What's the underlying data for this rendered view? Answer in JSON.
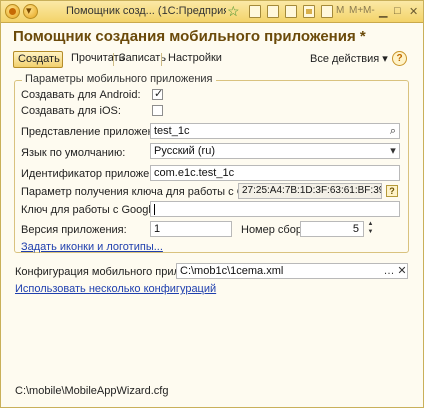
{
  "window": {
    "title": "Помощник созд... (1С:Предприятие)",
    "letters": {
      "m": "M",
      "m_plus": "M+",
      "m_minus": "M-"
    }
  },
  "form": {
    "title": "Помощник создания мобильного приложения *",
    "toolbar": {
      "create": "Создать",
      "read": "Прочитать",
      "write": "Записать",
      "settings": "Настройки",
      "all_actions": "Все действия ▾",
      "help": "?"
    },
    "group": {
      "caption": "Параметры мобильного приложения",
      "android_label": "Создавать для Android:",
      "android_checked": true,
      "ios_label": "Создавать для iOS:",
      "ios_checked": false,
      "app_view_label": "Представление приложения:",
      "app_view_value": "test_1c",
      "language_label": "Язык по умолчанию:",
      "language_value": "Русский (ru)",
      "app_id_label": "Идентификатор приложения:",
      "app_id_value": "com.e1c.test_1c",
      "maps_param_label": "Параметр получения ключа для работы с Google Maps:",
      "maps_param_value": "27:25:A4:7B:1D:3F:63:61:BF:39:8D:E",
      "maps_key_label": "Ключ для работы с Google Maps:",
      "maps_key_value": "",
      "version_label": "Версия приложения:",
      "version_value": "1",
      "build_label": "Номер сборки:",
      "build_value": "5",
      "icons_link": "Задать иконки и логотипы..."
    },
    "config_label": "Конфигурация мобильного приложения:",
    "config_value": "C:\\mob1c\\1cema.xml",
    "multi_config_link": "Использовать несколько конфигураций",
    "footer_path": "C:\\mobile\\MobileAppWizard.cfg"
  },
  "colors": {
    "title": "#6b4a0a",
    "link": "#1f3fae",
    "titlebar": "#f3d36a"
  }
}
